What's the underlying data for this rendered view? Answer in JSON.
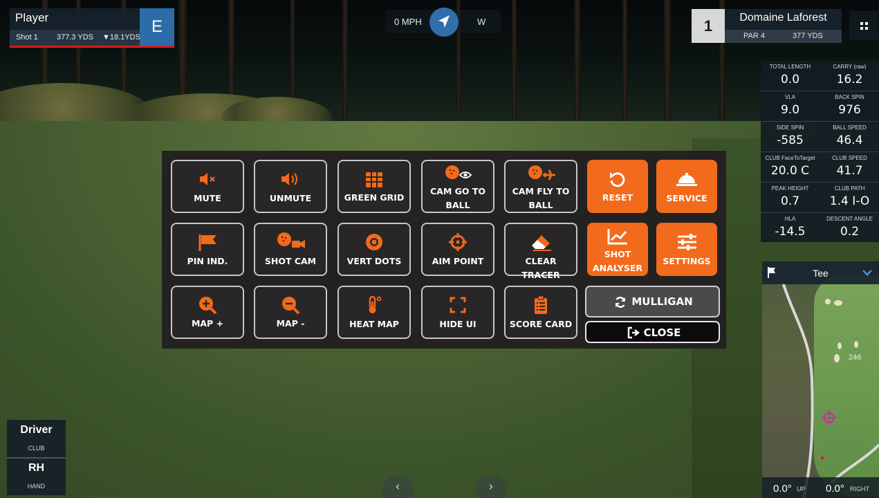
{
  "player": {
    "name": "Player",
    "shot": "Shot 1",
    "distance": "377.3 YDS",
    "remaining": "▼18.1YDS",
    "letter": "E"
  },
  "wind": {
    "speed": "0 MPH",
    "direction": "W"
  },
  "hole": {
    "number": "1",
    "course": "Domaine Laforest",
    "par": "PAR 4",
    "yards": "377 YDS"
  },
  "stats": [
    {
      "label": "TOTAL LENGTH",
      "value": "0.0"
    },
    {
      "label": "CARRY (raw)",
      "value": "16.2"
    },
    {
      "label": "VLA",
      "value": "9.0"
    },
    {
      "label": "BACK SPIN",
      "value": "976"
    },
    {
      "label": "SIDE SPIN",
      "value": "-585"
    },
    {
      "label": "BALL SPEED",
      "value": "46.4"
    },
    {
      "label": "CLUB FaceToTarget",
      "value": "20.0 C"
    },
    {
      "label": "CLUB SPEED",
      "value": "41.7"
    },
    {
      "label": "PEAK HEIGHT",
      "value": "0.7"
    },
    {
      "label": "CLUB PATH",
      "value": "1.4 I-O"
    },
    {
      "label": "HLA",
      "value": "-14.5"
    },
    {
      "label": "DESCENT ANGLE",
      "value": "0.2"
    }
  ],
  "map": {
    "title": "Tee",
    "distance_marker": "246",
    "up_value": "0.0°",
    "up_label": "UP",
    "right_value": "0.0°",
    "right_label": "RIGHT"
  },
  "club": {
    "name": "Driver",
    "name_label": "CLUB",
    "hand": "RH",
    "hand_label": "HAND"
  },
  "menu": {
    "row1": [
      "MUTE",
      "UNMUTE",
      "GREEN GRID",
      "CAM GO TO BALL",
      "CAM FLY TO BALL",
      "RESET",
      "SERVICE"
    ],
    "row2": [
      "PIN IND.",
      "SHOT CAM",
      "VERT DOTS",
      "AIM POINT",
      "CLEAR TRACER",
      "SHOT ANALYSER",
      "SETTINGS"
    ],
    "row3": [
      "MAP +",
      "MAP -",
      "HEAT MAP",
      "HIDE UI",
      "SCORE CARD"
    ],
    "mulligan": "MULLIGAN",
    "close": "CLOSE"
  },
  "colors": {
    "accent": "#f26a1b",
    "wind_badge": "#2f6faa",
    "player_badge": "#2d6ca8",
    "underline": "#d41f1f"
  },
  "icons": {
    "mute": "speaker-mute-icon",
    "unmute": "speaker-volume-icon",
    "green_grid": "grid-icon",
    "cam_go": "golfball-eye-icon",
    "cam_fly": "golfball-plane-icon",
    "reset": "rotate-left-icon",
    "service": "service-bell-icon",
    "pin": "flag-icon",
    "shot_cam": "golfball-camera-icon",
    "vert_dots": "dot-circle-icon",
    "aim": "crosshair-icon",
    "clear": "eraser-icon",
    "analyser": "chart-line-icon",
    "settings": "sliders-icon",
    "map_plus": "zoom-in-icon",
    "map_minus": "zoom-out-icon",
    "heat": "thermometer-icon",
    "hide": "expand-icon",
    "score": "clipboard-list-icon",
    "mulligan": "sync-icon",
    "close": "sign-out-icon"
  }
}
